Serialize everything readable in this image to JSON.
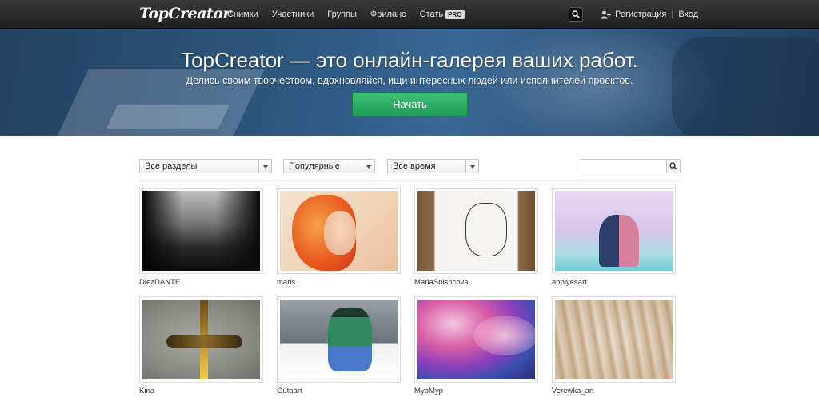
{
  "header": {
    "logo": "TopCreator",
    "nav": [
      {
        "label": "Снимки"
      },
      {
        "label": "Участники"
      },
      {
        "label": "Группы"
      },
      {
        "label": "Фриланс"
      },
      {
        "label": "Стать",
        "badge": "PRO"
      }
    ],
    "search_icon": "search-icon",
    "register_label": "Регистрация",
    "login_label": "Вход"
  },
  "hero": {
    "title": "TopCreator — это онлайн-галерея ваших работ.",
    "subtitle": "Делись своим творчеством, вдохновляйся, ищи интересных людей или исполнителей проектов.",
    "cta_label": "Начать",
    "cta_color": "#2fb566"
  },
  "filters": {
    "section": "Все разделы",
    "sort": "Популярные",
    "period": "Все время",
    "search_placeholder": ""
  },
  "gallery": [
    {
      "author": "DiezDANTE"
    },
    {
      "author": "maris"
    },
    {
      "author": "MariaShishcova"
    },
    {
      "author": "applyesart"
    },
    {
      "author": "Kina"
    },
    {
      "author": "Gutaart"
    },
    {
      "author": "МурМур"
    },
    {
      "author": "Verewka_art"
    }
  ]
}
